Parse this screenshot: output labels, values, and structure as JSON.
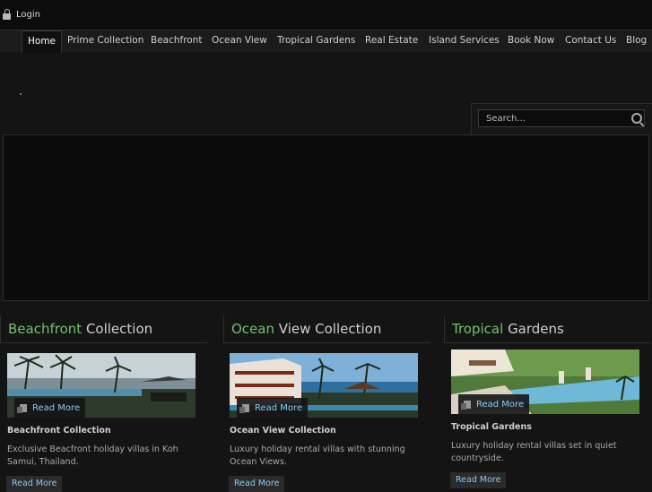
{
  "topbar": {
    "login_label": "Login"
  },
  "nav": {
    "items": [
      {
        "label": "Home"
      },
      {
        "label": "Prime Collection"
      },
      {
        "label": "Beachfront"
      },
      {
        "label": "Ocean View"
      },
      {
        "label": "Tropical Gardens"
      },
      {
        "label": "Real Estate"
      },
      {
        "label": "Island Services"
      },
      {
        "label": "Book Now"
      },
      {
        "label": "Contact Us"
      },
      {
        "label": "Blog"
      }
    ]
  },
  "search": {
    "placeholder": "Search..."
  },
  "columns": [
    {
      "title_accent": "Beachfront",
      "title_rest": "Collection",
      "image_label": "Read More",
      "item_title": "Beachfront Collection",
      "item_desc": "Exclusive Beacfront holiday villas in Koh Samui, Thailand.",
      "button": "Read More"
    },
    {
      "title_accent": "Ocean",
      "title_rest": "View Collection",
      "image_label": "Read More",
      "item_title": "Ocean View Collection",
      "item_desc": "Luxury holiday rental villas with stunning Ocean Views.",
      "button": "Read More"
    },
    {
      "title_accent": "Tropical",
      "title_rest": "Gardens",
      "image_label": "Read More",
      "item_title": "Tropical Gardens",
      "item_desc": "Luxury holiday rental villas set in quiet countryside.",
      "button": "Read More"
    }
  ],
  "colors": {
    "accent": "#6fc26f",
    "link": "#8fc9f0",
    "background": "#141414"
  }
}
